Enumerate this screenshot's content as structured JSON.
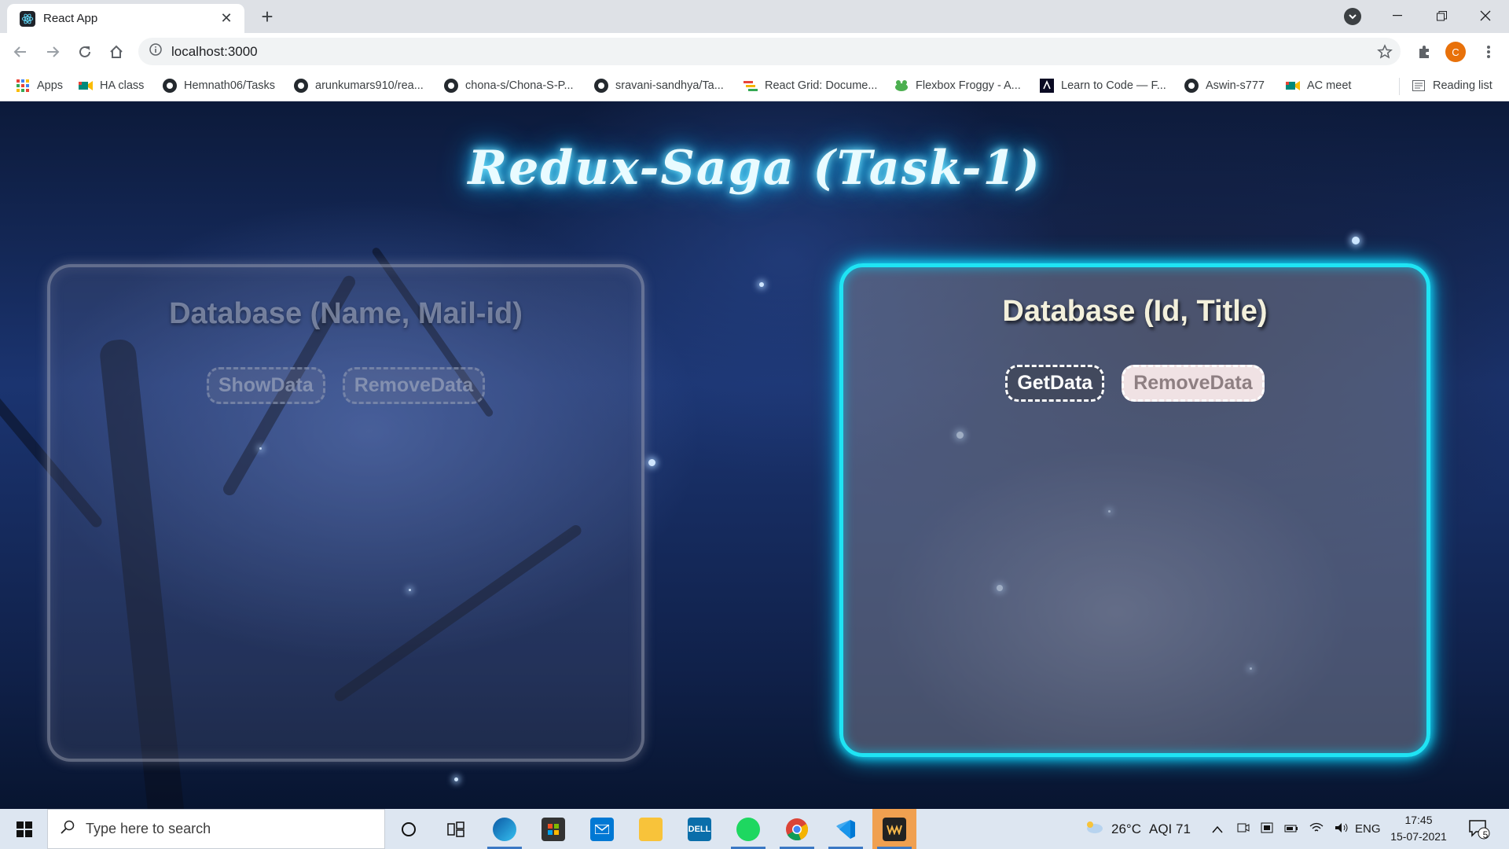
{
  "browser": {
    "tab_title": "React App",
    "address": "localhost:3000",
    "avatar_letter": "C",
    "bookmarks": [
      {
        "label": "Apps",
        "icon": "apps-grid-icon"
      },
      {
        "label": "HA class",
        "icon": "meet-icon"
      },
      {
        "label": "Hemnath06/Tasks",
        "icon": "github-icon"
      },
      {
        "label": "arunkumars910/rea...",
        "icon": "github-icon"
      },
      {
        "label": "chona-s/Chona-S-P...",
        "icon": "github-icon"
      },
      {
        "label": "sravani-sandhya/Ta...",
        "icon": "github-icon"
      },
      {
        "label": "React Grid: Docume...",
        "icon": "react-grid-icon"
      },
      {
        "label": "Flexbox Froggy - A...",
        "icon": "frog-icon"
      },
      {
        "label": "Learn to Code — F...",
        "icon": "freecodecamp-icon"
      },
      {
        "label": "Aswin-s777",
        "icon": "github-icon"
      },
      {
        "label": "AC meet",
        "icon": "meet-icon"
      }
    ],
    "reading_list": "Reading list"
  },
  "page": {
    "title": "Redux-Saga (Task-1)",
    "left_card": {
      "heading": "Database (Name, Mail-id)",
      "show_button": "ShowData",
      "remove_button": "RemoveData"
    },
    "right_card": {
      "heading": "Database (Id, Title)",
      "get_button": "GetData",
      "remove_button": "RemoveData"
    }
  },
  "taskbar": {
    "search_placeholder": "Type here to search",
    "weather": "26°C",
    "aqi": "AQI 71",
    "language": "ENG",
    "time": "17:45",
    "date": "15-07-2021",
    "notification_count": "5"
  },
  "colors": {
    "neon_cyan": "#1fe4f4",
    "title_glow": "#25c9ff",
    "avatar_orange": "#e8710a"
  }
}
